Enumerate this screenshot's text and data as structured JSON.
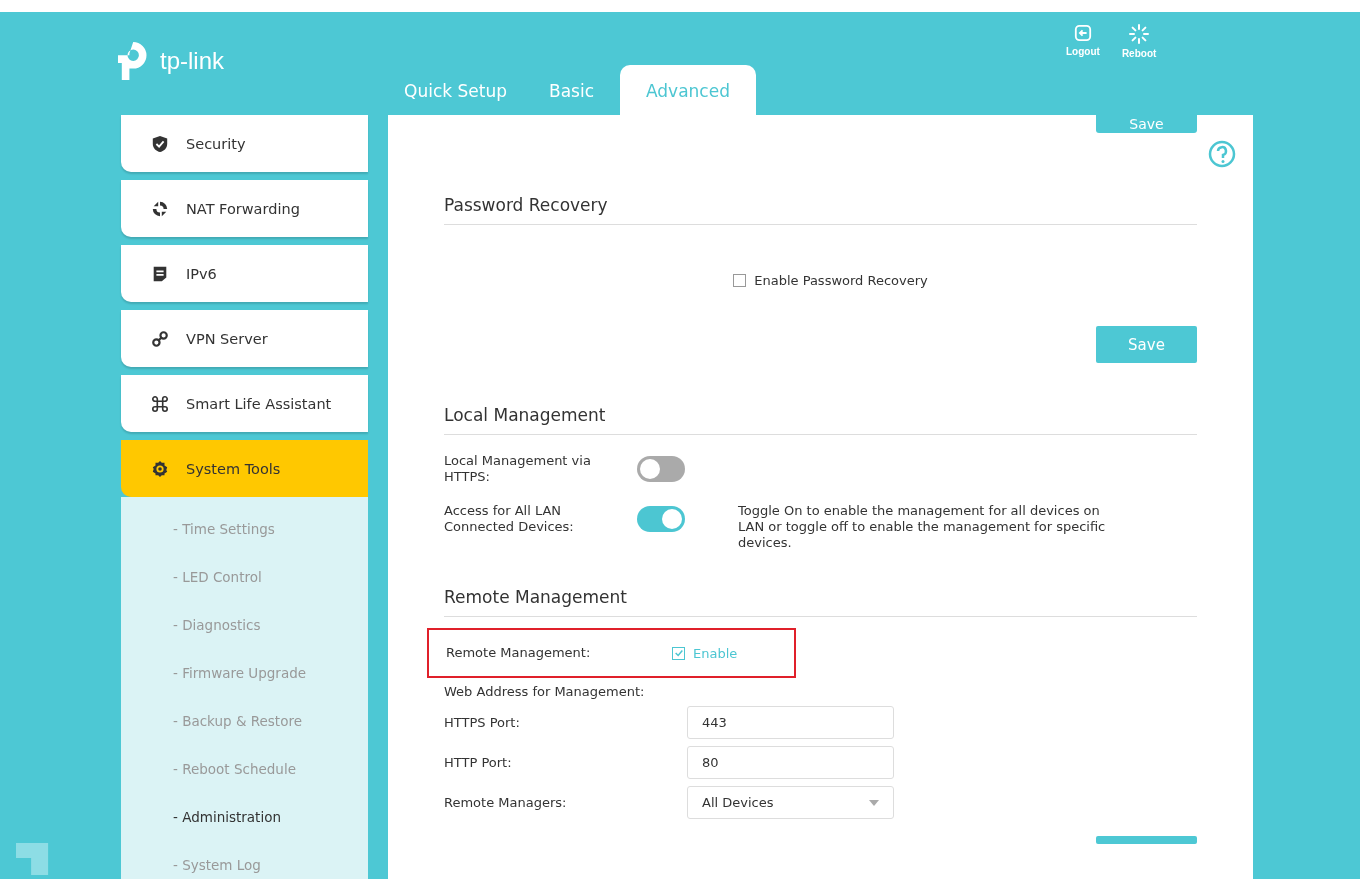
{
  "header": {
    "logo": "tp-link",
    "tabs": [
      {
        "label": "Quick Setup",
        "selected": false
      },
      {
        "label": "Basic",
        "selected": false
      },
      {
        "label": "Advanced",
        "selected": true
      }
    ],
    "actions": [
      {
        "kind": "logout",
        "label": "Logout"
      },
      {
        "kind": "reboot",
        "label": "Reboot"
      }
    ]
  },
  "sidebar": {
    "items": [
      {
        "kind": "shield",
        "label": "Security",
        "selected": false
      },
      {
        "kind": "nat",
        "label": "NAT Forwarding",
        "selected": false
      },
      {
        "kind": "doc",
        "label": "IPv6",
        "selected": false
      },
      {
        "kind": "link",
        "label": "VPN Server",
        "selected": false
      },
      {
        "kind": "command",
        "label": "Smart Life Assistant",
        "selected": false
      },
      {
        "kind": "gear",
        "label": "System Tools",
        "selected": true,
        "expanded": true,
        "children": [
          {
            "label": "- Time Settings",
            "selected": false
          },
          {
            "label": "- LED Control",
            "selected": false
          },
          {
            "label": "- Diagnostics",
            "selected": false
          },
          {
            "label": "- Firmware Upgrade",
            "selected": false
          },
          {
            "label": "- Backup & Restore",
            "selected": false
          },
          {
            "label": "- Reboot Schedule",
            "selected": false
          },
          {
            "label": "- Administration",
            "selected": true
          },
          {
            "label": "- System Log",
            "selected": false
          }
        ]
      }
    ]
  },
  "content": {
    "top_save_button": "Save",
    "password_recovery": {
      "title": "Password Recovery",
      "checkbox": {
        "label": "Enable Password Recovery",
        "checked": false
      },
      "save_button": "Save"
    },
    "local_management": {
      "title": "Local Management",
      "rows": [
        {
          "label": "Local Management via HTTPS:",
          "on": false
        },
        {
          "label": "Access for All LAN Connected Devices:",
          "on": true,
          "note": "Toggle On to enable the management for all devices on LAN or toggle off to enable the management for specific devices."
        }
      ]
    },
    "remote_management": {
      "title": "Remote Management",
      "highlighted": true,
      "enable": {
        "label": "Remote Management:",
        "text": "Enable",
        "checked": true
      },
      "web_address_label": "Web Address for Management:",
      "fields": [
        {
          "kind": "input",
          "label": "HTTPS Port:",
          "value": "443"
        },
        {
          "kind": "input",
          "label": "HTTP Port:",
          "value": "80"
        },
        {
          "kind": "select",
          "label": "Remote Managers:",
          "value": "All Devices"
        }
      ]
    }
  }
}
